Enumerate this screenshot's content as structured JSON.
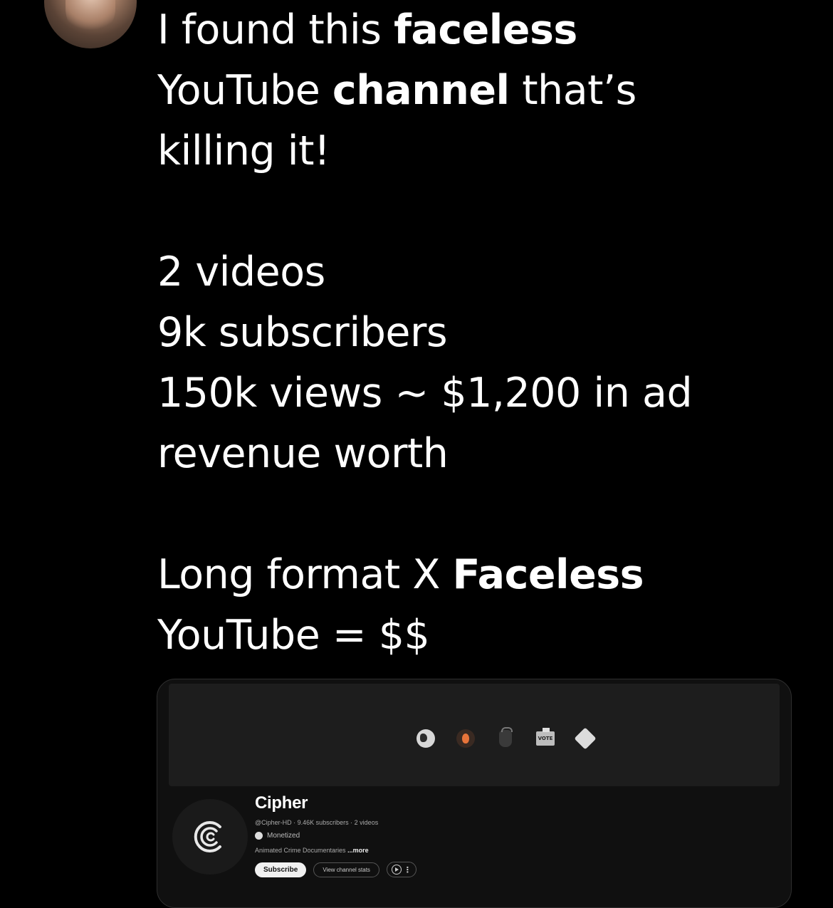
{
  "post": {
    "line1_a": "I found this ",
    "line1_b": "faceless",
    "line2_a": "YouTube ",
    "line2_b": "channel",
    "line2_c": " that’s",
    "line3": "killing it!",
    "line4": "2 videos",
    "line5": "9k subscribers",
    "line6": "150k views ~ $1,200 in ad",
    "line7": "revenue worth",
    "line8_a": "Long format X ",
    "line8_b": "Faceless",
    "line9": "YouTube = $$"
  },
  "channel": {
    "name": "Cipher",
    "meta": "@Cipher-HD · 9.46K subscribers · 2 videos",
    "monetized": "Monetized",
    "description": "Animated Crime Documentaries ",
    "more": "...more",
    "subscribe": "Subscribe",
    "view_stats": "View channel stats",
    "vote_label": "VOTE"
  },
  "icons": [
    "globe-icon",
    "fire-icon",
    "kettlebell-icon",
    "vote-box-icon",
    "ticket-icon",
    "play-icon",
    "more-vert-icon"
  ]
}
